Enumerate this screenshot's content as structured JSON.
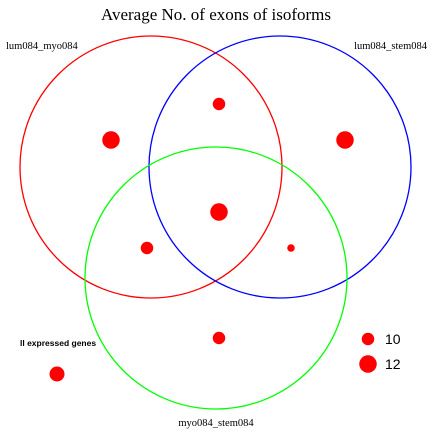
{
  "chart_data": {
    "type": "venn",
    "title": "Average No. of exons of isoforms",
    "sets": [
      {
        "name": "lum084_myo084",
        "color": "#ff0000"
      },
      {
        "name": "lum084_stem084",
        "color": "#0000ff"
      },
      {
        "name": "myo084_stem084",
        "color": "#00ff00"
      }
    ],
    "regions": [
      {
        "sets": [
          "lum084_myo084"
        ],
        "value": 12
      },
      {
        "sets": [
          "lum084_stem084"
        ],
        "value": 12
      },
      {
        "sets": [
          "lum084_myo084",
          "lum084_stem084"
        ],
        "value": 10
      },
      {
        "sets": [
          "lum084_myo084",
          "lum084_stem084",
          "myo084_stem084"
        ],
        "value": 12
      },
      {
        "sets": [
          "lum084_myo084",
          "myo084_stem084"
        ],
        "value": 10
      },
      {
        "sets": [
          "lum084_stem084",
          "myo084_stem084"
        ],
        "value": 8
      },
      {
        "sets": [
          "myo084_stem084"
        ],
        "value": 10
      },
      {
        "sets": [],
        "label": "ll expressed genes",
        "value": 11
      }
    ],
    "dot_color": "#ff0000",
    "size_legend": {
      "values": [
        10,
        12
      ],
      "labels": [
        "10",
        "12"
      ],
      "placement": "bottom-right"
    }
  }
}
